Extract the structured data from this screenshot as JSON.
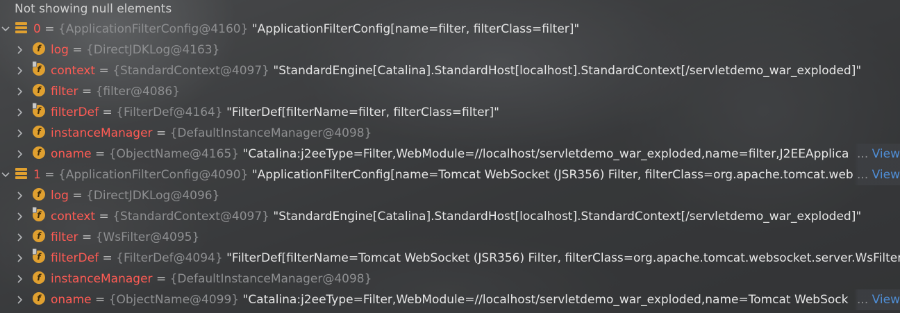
{
  "header": {
    "text": "Not showing null elements"
  },
  "view_link": "View",
  "ellipsis": "...",
  "rows": [
    {
      "kind": "array",
      "name": "0",
      "ref": "{ApplicationFilterConfig@4160}",
      "value": "\"ApplicationFilterConfig[name=filter, filterClass=filter]\"",
      "truncated": false
    },
    {
      "kind": "field",
      "name": "log",
      "ref": "{DirectJDKLog@4163}",
      "value": "",
      "truncated": false,
      "lock": false
    },
    {
      "kind": "field",
      "name": "context",
      "ref": "{StandardContext@4097}",
      "value": "\"StandardEngine[Catalina].StandardHost[localhost].StandardContext[/servletdemo_war_exploded]\"",
      "truncated": false,
      "lock": true
    },
    {
      "kind": "field",
      "name": "filter",
      "ref": "{filter@4086}",
      "value": "",
      "truncated": false,
      "lock": false
    },
    {
      "kind": "field",
      "name": "filterDef",
      "ref": "{FilterDef@4164}",
      "value": "\"FilterDef[filterName=filter, filterClass=filter]\"",
      "truncated": false,
      "lock": true
    },
    {
      "kind": "field",
      "name": "instanceManager",
      "ref": "{DefaultInstanceManager@4098}",
      "value": "",
      "truncated": false,
      "lock": false
    },
    {
      "kind": "field",
      "name": "oname",
      "ref": "{ObjectName@4165}",
      "value": "\"Catalina:j2eeType=Filter,WebModule=//localhost/servletdemo_war_exploded,name=filter,J2EEApplica",
      "truncated": true,
      "lock": false
    },
    {
      "kind": "array",
      "name": "1",
      "ref": "{ApplicationFilterConfig@4090}",
      "value": "\"ApplicationFilterConfig[name=Tomcat WebSocket (JSR356) Filter, filterClass=org.apache.tomcat.web",
      "truncated": true
    },
    {
      "kind": "field",
      "name": "log",
      "ref": "{DirectJDKLog@4096}",
      "value": "",
      "truncated": false,
      "lock": false
    },
    {
      "kind": "field",
      "name": "context",
      "ref": "{StandardContext@4097}",
      "value": "\"StandardEngine[Catalina].StandardHost[localhost].StandardContext[/servletdemo_war_exploded]\"",
      "truncated": false,
      "lock": true
    },
    {
      "kind": "field",
      "name": "filter",
      "ref": "{WsFilter@4095}",
      "value": "",
      "truncated": false,
      "lock": false
    },
    {
      "kind": "field",
      "name": "filterDef",
      "ref": "{FilterDef@4094}",
      "value": "\"FilterDef[filterName=Tomcat WebSocket (JSR356) Filter, filterClass=org.apache.tomcat.websocket.server.WsFilter",
      "truncated": false,
      "lock": true
    },
    {
      "kind": "field",
      "name": "instanceManager",
      "ref": "{DefaultInstanceManager@4098}",
      "value": "",
      "truncated": false,
      "lock": false
    },
    {
      "kind": "field",
      "name": "oname",
      "ref": "{ObjectName@4099}",
      "value": "\"Catalina:j2eeType=Filter,WebModule=//localhost/servletdemo_war_exploded,name=Tomcat WebSock",
      "truncated": true,
      "lock": false
    }
  ],
  "colors": {
    "field_name": "#ff5b54",
    "field_icon": "#e0a030",
    "reference": "#8e8f91",
    "value": "#e6e6e6",
    "link": "#4f8ed6"
  },
  "icons": {
    "expand": "chevron-right-icon",
    "collapse": "chevron-down-icon",
    "field": "field-f-icon",
    "array_element": "array-element-icon"
  }
}
